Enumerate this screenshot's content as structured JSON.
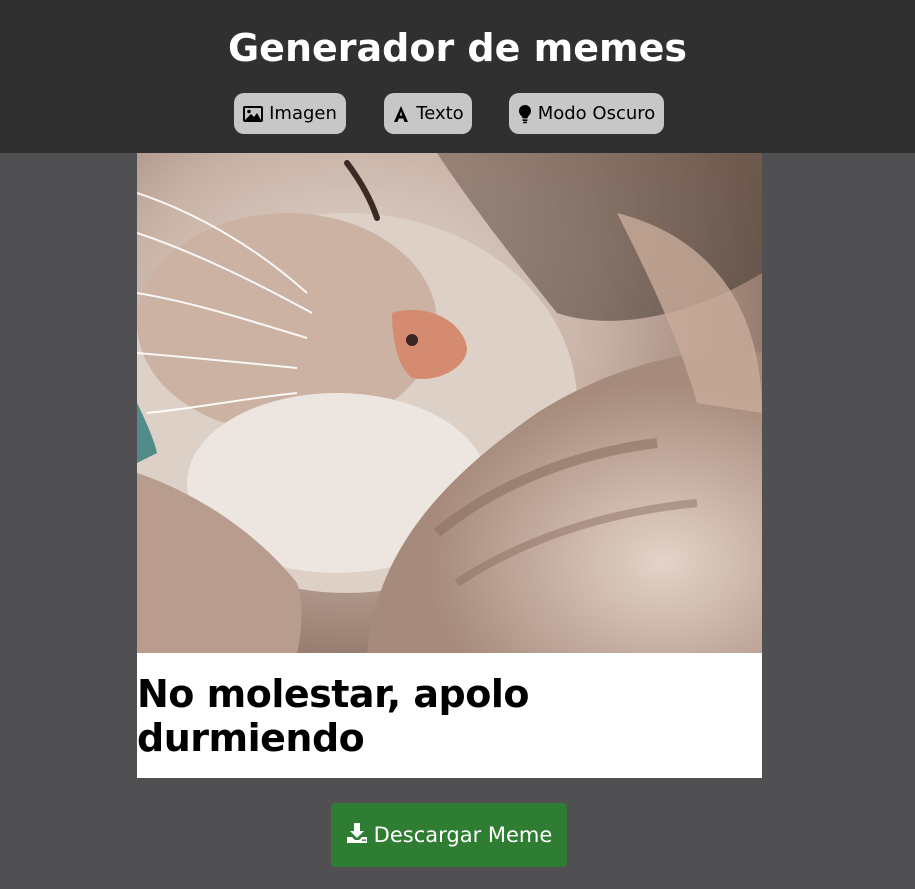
{
  "header": {
    "title": "Generador de memes",
    "buttons": [
      {
        "label": "Imagen",
        "icon": "image-icon"
      },
      {
        "label": "Texto",
        "icon": "text-icon"
      },
      {
        "label": "Modo Oscuro",
        "icon": "lightbulb-icon"
      }
    ]
  },
  "meme": {
    "image_description_icon": "cat-photo",
    "caption": "No molestar, apolo durmiendo"
  },
  "download": {
    "label": "Descargar Meme",
    "icon": "download-icon"
  },
  "colors": {
    "background": "#505052",
    "header": "#303030",
    "nav_button": "#c7c7c7",
    "download_button": "#2e7d32"
  }
}
